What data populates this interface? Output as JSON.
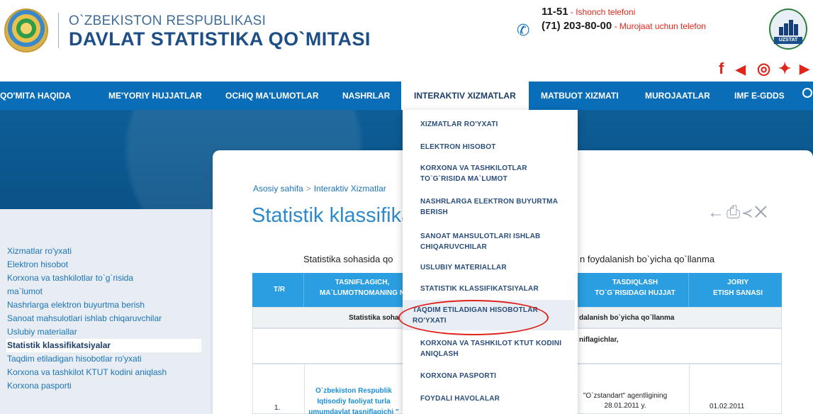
{
  "header": {
    "org_small": "O`ZBEKISTON RESPUBLIKASI",
    "org_big": "DAVLAT STATISTIKA QO`MITASI",
    "phone1_num": "11-51",
    "phone1_desc": " - Ishonch telefoni",
    "phone2_num": "(71) 203-80-00",
    "phone2_desc": " - Murojaat uchun telefon",
    "logo_label": "UZSTAT"
  },
  "social": [
    {
      "icon": "facebook-icon",
      "glyph": "f",
      "color": "#e0261b"
    },
    {
      "icon": "telegram-icon",
      "glyph": "◀",
      "color": "#e0261b"
    },
    {
      "icon": "instagram-icon",
      "glyph": "◎",
      "color": "#e0261b"
    },
    {
      "icon": "twitter-icon",
      "glyph": "✦",
      "color": "#e0261b"
    },
    {
      "icon": "youtube-icon",
      "glyph": "▶",
      "color": "#e0261b"
    }
  ],
  "nav": {
    "items": [
      "QO'MITA HAQIDA",
      "ME'YORIY HUJJATLAR",
      "OCHIQ MA'LUMOTLAR",
      "NASHRLAR",
      "INTERAKTIV XIZMATLAR",
      "MATBUOT XIZMATI",
      "MUROJAATLAR",
      "IMF E-GDDS"
    ],
    "active_index": 4
  },
  "dropdown": {
    "items": [
      "XIZMATLAR RO'YXATI",
      "ELEKTRON HISOBOT",
      "KORXONA VA TASHKILOTLAR\nTO`G`RISIDA MA`LUMOT",
      "NASHRLARGA ELEKTRON BUYURTMA\nBERISH",
      "SANOAT MAHSULOTLARI ISHLAB\nCHIQARUVCHILAR",
      "USLUBIY MATERIALLAR",
      "STATISTIK KLASSIFIKATSIYALAR",
      "TAQDIM ETILADIGAN HISOBOTLAR\nRO'YXATI",
      "KORXONA VA TASHKILOT KTUT KODINI\nANIQLASH",
      "KORXONA PASPORTI",
      "FOYDALI HAVOLALAR"
    ],
    "highlighted_index": 7
  },
  "sidemenu": {
    "items": [
      "Xizmatlar ro'yxati",
      "Elektron hisobot",
      "Korxona va tashkilotlar to`g`risida ma`lumot",
      "Nashrlarga elektron buyurtma berish",
      "Sanoat mahsulotlari ishlab chiqaruvchilar",
      "Uslubiy materiallar",
      "Statistik klassifikatsiyalar",
      "Taqdim etiladigan hisobotlar ro'yxati",
      "Korxona va tashkilot KTUT kodini aniqlash",
      "Korxona pasporti"
    ],
    "active_index": 6
  },
  "content": {
    "breadcrumb_home": "Asosiy sahifa",
    "breadcrumb_sep": ">",
    "breadcrumb_current": "Interaktiv Xizmatlar",
    "title": "Statistik klassifika",
    "subtitle_left": "Statistika sohasida qo",
    "subtitle_right": "n foydalanish bo`yicha qo`llanma",
    "table": {
      "h_tr": "T/R",
      "h_tasnif": "TASNIFLAGICH,\nMA`LUMOTNOMANING N",
      "h_tasdiq": "TASDIQLASH\nTO`G`RISIDAGI HUJJAT",
      "h_joriy": "JORIY\nETISH SANASI",
      "row1_left": "Statistika soha",
      "row1_right": "dalanish bo`yicha qo`llanma",
      "row2_right": "niflagichlar,",
      "row3_num": "1.",
      "row3_name": "O`zbekiston Respublik\nIqtisodiy faoliyat turla\numumdavlat tasniflagichi \"",
      "row3_doc": "\"O`zstandart\" agentligining\n28.01.2011 y.",
      "row3_date": "01.02.2011"
    }
  }
}
